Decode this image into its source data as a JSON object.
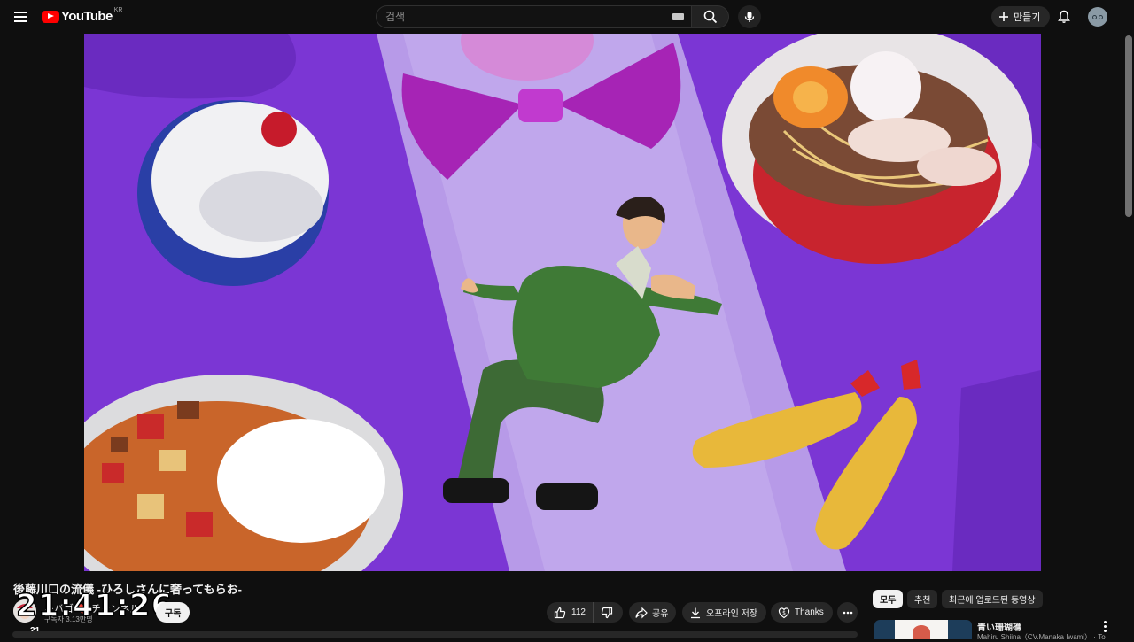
{
  "header": {
    "logo_text": "YouTube",
    "country_code": "KR",
    "search_placeholder": "검색",
    "create_label": "만들기"
  },
  "video": {
    "title": "後藤川口の流儀 -ひろしさんに奢ってもらお-",
    "channel_name": "キバゴ ❤️ チャンネル",
    "subscriber_count": "구독자 3.13만명",
    "subscribe_label": "구독",
    "like_count": "112",
    "share_label": "공유",
    "save_label": "오프라인 저장",
    "thanks_label": "Thanks"
  },
  "overlay": {
    "clock": "21:41:26",
    "clock_sub": "21"
  },
  "sidebar": {
    "chips": [
      {
        "label": "모두",
        "active": true
      },
      {
        "label": "추천",
        "active": false
      },
      {
        "label": "최근에 업로드된 동영상",
        "active": false
      }
    ],
    "recommendation": {
      "title": "青い珊瑚礁",
      "channel": "Mahiru Shiina（CV.Manaka Iwami） · To"
    }
  },
  "icons": [
    "menu-icon",
    "youtube-logo-icon",
    "keyboard-icon",
    "search-icon",
    "mic-icon",
    "plus-icon",
    "bell-icon",
    "thumbs-up-icon",
    "thumbs-down-icon",
    "share-icon",
    "download-icon",
    "thanks-icon",
    "more-icon",
    "kebab-icon"
  ],
  "colors": {
    "background": "#0f0f0f",
    "brand_red": "#ff0000",
    "video_bg": "#7a35d6",
    "pill_bg": "#272727"
  }
}
